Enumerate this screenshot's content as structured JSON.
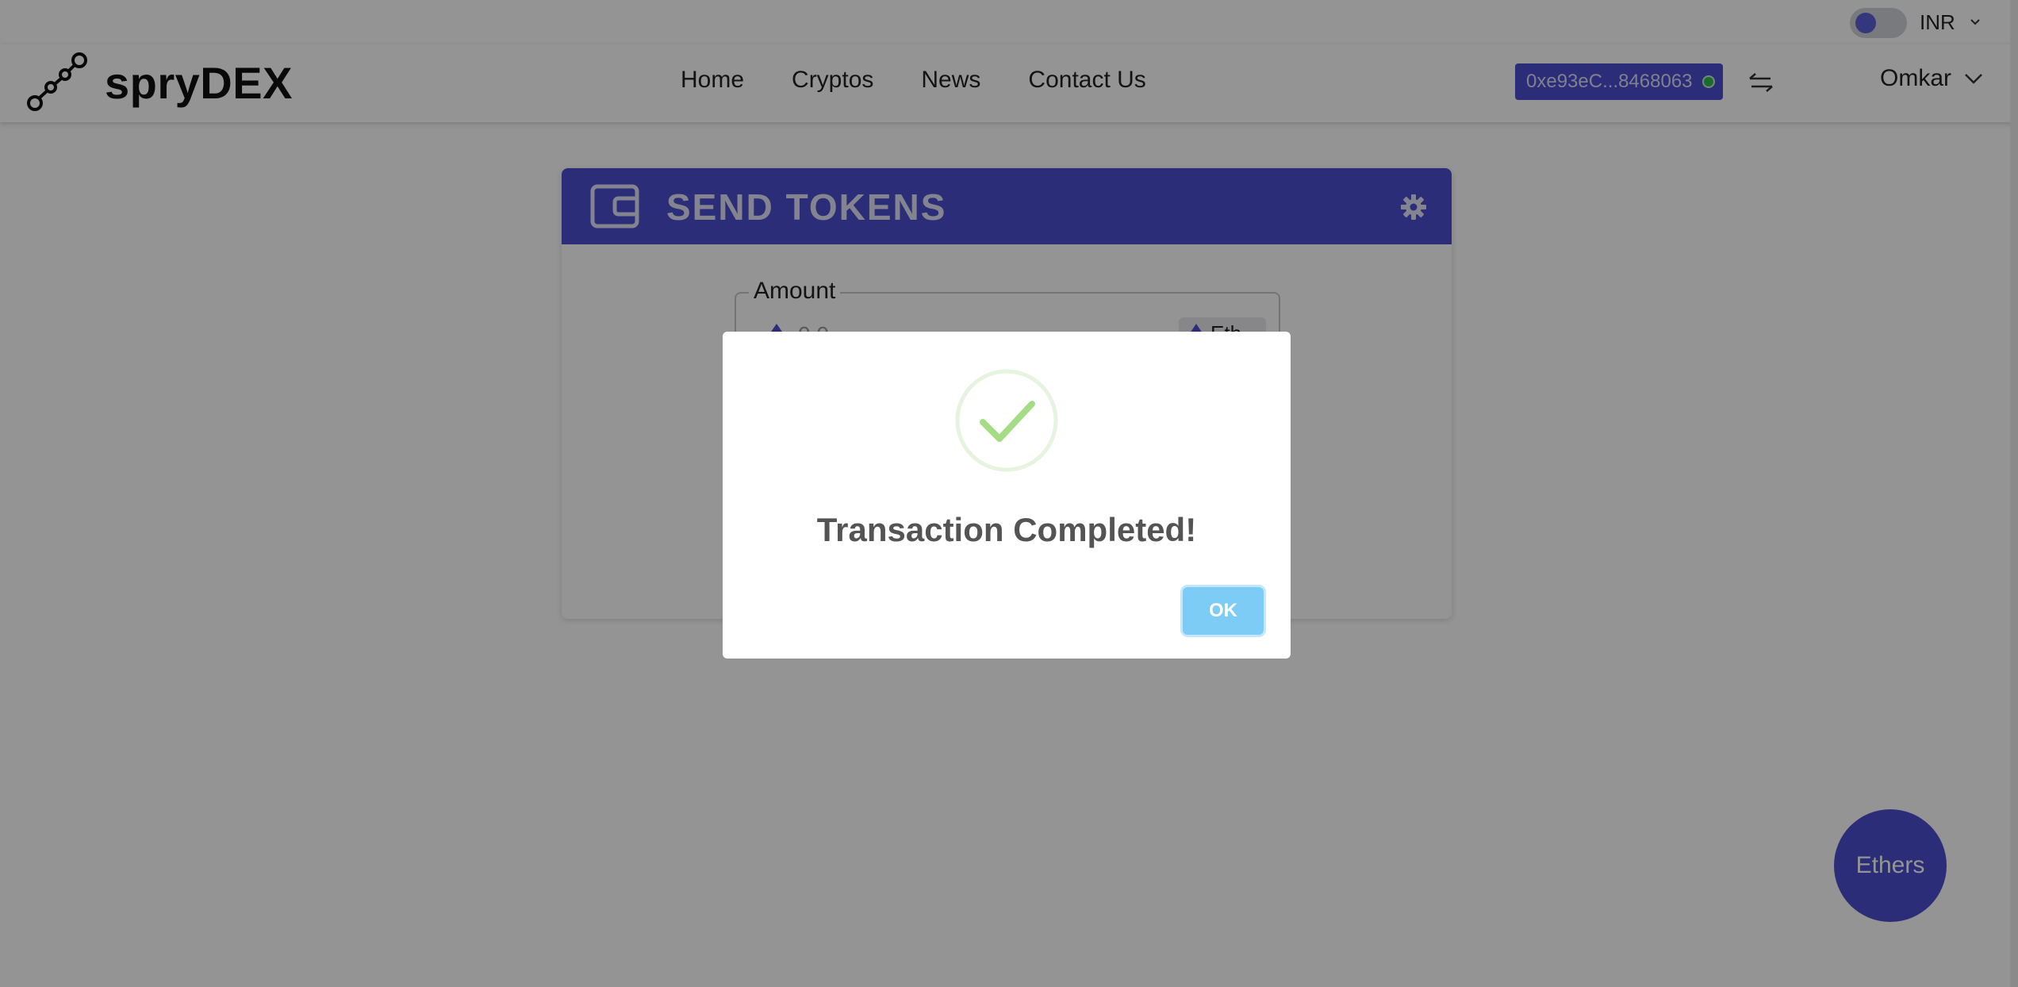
{
  "utility_bar": {
    "currency": "INR",
    "toggle_on": false
  },
  "navbar": {
    "brand": "spryDEX",
    "links": [
      "Home",
      "Cryptos",
      "News",
      "Contact Us"
    ],
    "wallet_address": "0xe93eC...8468063",
    "wallet_status_color": "#2fb84a",
    "user_name": "Omkar"
  },
  "send_tokens": {
    "title": "SEND TOKENS",
    "amount_label": "Amount",
    "amount_placeholder": "0.0",
    "token_chip": "Eth"
  },
  "fab": {
    "label": "Ethers"
  },
  "dialog": {
    "title": "Transaction Completed!",
    "ok_label": "OK",
    "icon": "success-check-icon"
  },
  "colors": {
    "accent": "#4c4fd0",
    "ok_button": "#7cccf6",
    "success": "#a5dc86"
  }
}
